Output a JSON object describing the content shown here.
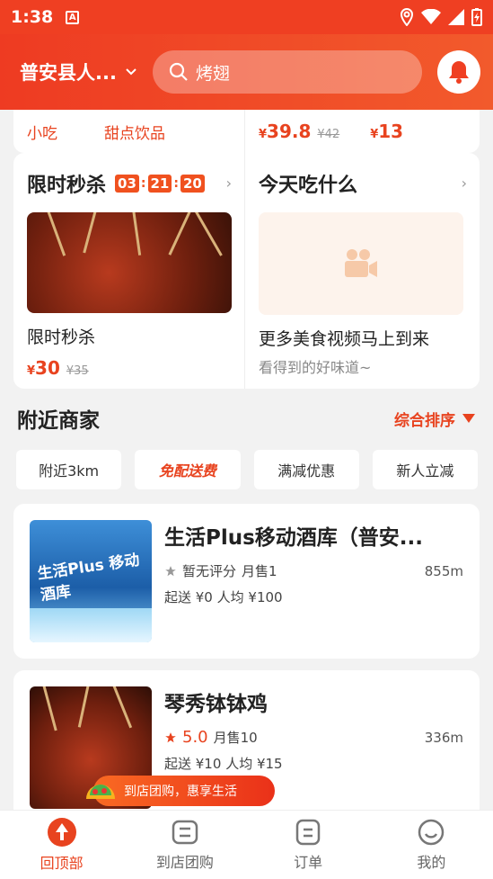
{
  "status_bar": {
    "time": "1:38"
  },
  "header": {
    "location": "普安县人...",
    "search_placeholder": "烤翅"
  },
  "top_card": {
    "left_items": [
      "小吃",
      "甜点饮品"
    ],
    "prices": [
      {
        "price": "39.8",
        "original": "¥42"
      },
      {
        "price": "13"
      }
    ]
  },
  "flash_sale": {
    "title": "限时秒杀",
    "countdown": [
      "03",
      "21",
      "20"
    ],
    "item_name": "限时秒杀",
    "price": "30",
    "original": "¥35"
  },
  "what_to_eat": {
    "title": "今天吃什么",
    "headline": "更多美食视频马上到来",
    "subtitle": "看得到的好味道~"
  },
  "nearby": {
    "title": "附近商家",
    "sort_label": "综合排序",
    "filters": [
      "附近3km",
      "免配送费",
      "满减优惠",
      "新人立减"
    ]
  },
  "shops": [
    {
      "name": "生活Plus移动酒库（普安...",
      "rating": "暂无评分",
      "monthly": "月售1",
      "distance": "855m",
      "min_order": "起送 ¥0",
      "avg": "人均 ¥100",
      "image_text": "生活Plus 移动酒库"
    },
    {
      "name": "琴秀钵钵鸡",
      "rating": "5.0",
      "monthly": "月售10",
      "distance": "336m",
      "min_order": "起送 ¥10",
      "avg": "人均 ¥15"
    }
  ],
  "promo_banner": "到店团购，惠享生活",
  "tabs": [
    {
      "label": "回顶部",
      "icon": "back-top-icon"
    },
    {
      "label": "到店团购",
      "icon": "group-buy-icon"
    },
    {
      "label": "订单",
      "icon": "order-icon"
    },
    {
      "label": "我的",
      "icon": "profile-icon"
    }
  ],
  "colors": {
    "accent": "#ef3f22",
    "price": "#e8431f"
  }
}
